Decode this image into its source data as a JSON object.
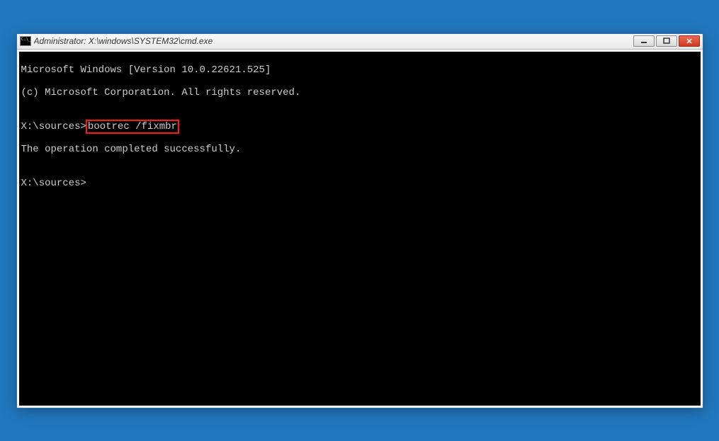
{
  "window": {
    "title": "Administrator: X:\\windows\\SYSTEM32\\cmd.exe"
  },
  "terminal": {
    "line1": "Microsoft Windows [Version 10.0.22621.525]",
    "line2": "(c) Microsoft Corporation. All rights reserved.",
    "blank1": "",
    "prompt1_prefix": "X:\\sources>",
    "prompt1_command": "bootrec /fixmbr",
    "result1": "The operation completed successfully.",
    "blank2": "",
    "prompt2": "X:\\sources>"
  }
}
